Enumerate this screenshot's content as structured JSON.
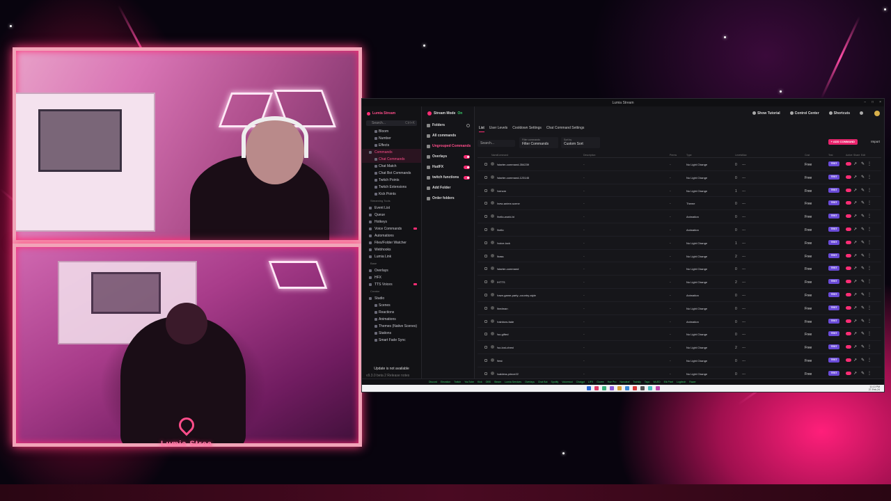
{
  "window": {
    "title": "Lumia Stream"
  },
  "overlay": {
    "brand_text": "Lumia Strea"
  },
  "sidebar": {
    "brand": "Lumia Stream",
    "search_placeholder": "Search...",
    "search_shortcut": "Ctrl+K",
    "items": [
      {
        "label": "Bloom",
        "type": "sub"
      },
      {
        "label": "Number",
        "type": "sub"
      },
      {
        "label": "Effects",
        "type": "sub"
      },
      {
        "label": "Commands",
        "type": "item",
        "active": true
      },
      {
        "label": "Chat Commands",
        "type": "sub",
        "active": true
      },
      {
        "label": "Chat Match",
        "type": "sub"
      },
      {
        "label": "Chat Bot Commands",
        "type": "sub"
      },
      {
        "label": "Twitch Points",
        "type": "sub"
      },
      {
        "label": "Twitch Extensions",
        "type": "sub"
      },
      {
        "label": "Kick Points",
        "type": "sub"
      },
      {
        "label": "Streaming Tools",
        "type": "section"
      },
      {
        "label": "Event List",
        "type": "item"
      },
      {
        "label": "Queue",
        "type": "item"
      },
      {
        "label": "Hotkeys",
        "type": "item"
      },
      {
        "label": "Voice Commands",
        "type": "item",
        "badge": true
      },
      {
        "label": "Automations",
        "type": "item"
      },
      {
        "label": "Files/Folder Watcher",
        "type": "item"
      },
      {
        "label": "Webhooks",
        "type": "item"
      },
      {
        "label": "Lumia Link",
        "type": "item"
      },
      {
        "label": "Base",
        "type": "section"
      },
      {
        "label": "Overlays",
        "type": "item"
      },
      {
        "label": "HFX",
        "type": "item"
      },
      {
        "label": "TTS Voices",
        "type": "item",
        "badge": true
      },
      {
        "label": "Creator",
        "type": "section"
      },
      {
        "label": "Studio",
        "type": "item"
      },
      {
        "label": "Scenes",
        "type": "sub"
      },
      {
        "label": "Reactions",
        "type": "sub"
      },
      {
        "label": "Animations",
        "type": "sub"
      },
      {
        "label": "Themes (Native Scenes)",
        "type": "sub"
      },
      {
        "label": "Stations",
        "type": "sub"
      },
      {
        "label": "Smart Fade Sync",
        "type": "sub"
      }
    ],
    "update_text": "Update is not available",
    "version_text": "v9.3.0 beta 2   Release notes"
  },
  "folders": {
    "stream_mode_label": "Stream Mode",
    "stream_mode_state": "On",
    "items": [
      {
        "label": "Folders",
        "control": "gear"
      },
      {
        "label": "All commands",
        "control": "none"
      },
      {
        "label": "Ungrouped Commands",
        "control": "none",
        "active": true
      },
      {
        "label": "Overlays",
        "control": "toggle"
      },
      {
        "label": "HudFX",
        "control": "toggle"
      },
      {
        "label": "twitch functions",
        "control": "toggle"
      },
      {
        "label": "Add Folder",
        "control": "none"
      },
      {
        "label": "Order folders",
        "control": "none"
      }
    ]
  },
  "topbar": {
    "show_tutorial": "Show Tutorial",
    "control_center": "Control Center",
    "shortcuts": "Shortcuts"
  },
  "tabs": [
    "List",
    "User Levels",
    "Cooldown Settings",
    "Chat Command Settings"
  ],
  "filters": {
    "search_placeholder": "Search...",
    "filter_label": "Filter commands",
    "filter_value": "Filter Commands",
    "sort_label": "Sort by",
    "sort_value": "Custom Sort",
    "add_button": "+ ADD COMMAND",
    "import_button": "Import"
  },
  "table": {
    "headers": [
      "Name",
      "Command",
      "Description",
      "Perms",
      "Type",
      "Levels",
      "Max",
      "Cost",
      "Test",
      "Active",
      "Share",
      "Edit"
    ],
    "rows": [
      {
        "name": "!starter-command-354239",
        "type": "No Light Change",
        "perm": "-",
        "level": "0",
        "cost": "Free"
      },
      {
        "name": "!starter-command-123145",
        "type": "No Light Change",
        "perm": "-",
        "level": "0",
        "cost": "Free"
      },
      {
        "name": "!venom",
        "type": "No Light Change",
        "perm": "-",
        "level": "1",
        "cost": "Free"
      },
      {
        "name": "!new-anime-scene",
        "type": "Theme",
        "perm": "-",
        "level": "0",
        "cost": "Free"
      },
      {
        "name": "!hello-world-hi",
        "type": "Animation",
        "perm": "-",
        "level": "0",
        "cost": "Free"
      },
      {
        "name": "!hello",
        "type": "Animation",
        "perm": "-",
        "level": "0",
        "cost": "Free"
      },
      {
        "name": "!voice-lock",
        "type": "No Light Change",
        "perm": "-",
        "level": "1",
        "cost": "Free"
      },
      {
        "name": "!bass",
        "type": "No Light Change",
        "perm": "-",
        "level": "2",
        "cost": "Free"
      },
      {
        "name": "!starter-command",
        "type": "No Light Change",
        "perm": "-",
        "level": "0",
        "cost": "Free"
      },
      {
        "name": "!HTTS",
        "type": "No Light Change",
        "perm": "-",
        "level": "2",
        "cost": "Free"
      },
      {
        "name": "!rave-game-party--country-style",
        "type": "Animation",
        "perm": "-",
        "level": "0",
        "cost": "Free"
      },
      {
        "name": "!bedman",
        "type": "No Light Change",
        "perm": "-",
        "level": "0",
        "cost": "Free"
      },
      {
        "name": "!rainbow-fade",
        "type": "Animation",
        "perm": "-",
        "level": "0",
        "cost": "Free"
      },
      {
        "name": "!so-gifted",
        "type": "No Light Change",
        "perm": "-",
        "level": "0",
        "cost": "Free"
      },
      {
        "name": "!so-lost-chest",
        "type": "No Light Change",
        "perm": "-",
        "level": "2",
        "cost": "Free"
      },
      {
        "name": "!test",
        "type": "No Light Change",
        "perm": "-",
        "level": "0",
        "cost": "Free"
      },
      {
        "name": "!caldera-prince22",
        "type": "No Light Change",
        "perm": "-",
        "level": "0",
        "cost": "Free"
      }
    ],
    "test_label": "TEST",
    "max_placeholder": "---"
  },
  "status_strip": [
    "Discord",
    "Elevation",
    "Twitch",
    "YouTube",
    "Kick",
    "OBS",
    "Steam",
    "Lumia Services",
    "Overlays",
    "Chat Bot",
    "Spotify",
    "Voicemod",
    "Chatgpt",
    "LIFX",
    "Govee",
    "Hue Pro",
    "Nanoleaf",
    "Twinkly",
    "Tapo",
    "WLED",
    "Elk Pixel",
    "Logitech",
    "Razer"
  ],
  "clock": {
    "time": "11:13 PM",
    "date": "27-Feb-24"
  }
}
